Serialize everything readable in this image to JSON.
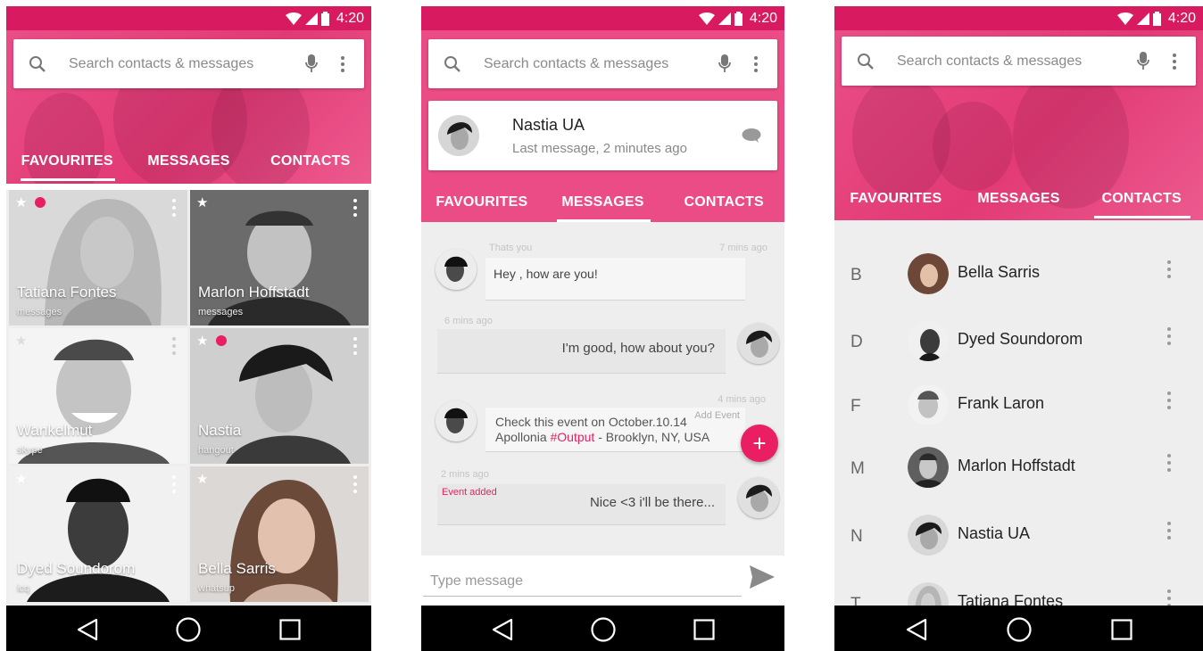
{
  "status_bar": {
    "time": "4:20"
  },
  "search": {
    "placeholder": "Search contacts & messages"
  },
  "tabs": {
    "favourites": "FAVOURITES",
    "messages": "MESSAGES",
    "contacts": "CONTACTS"
  },
  "favourites": [
    {
      "name": "Tatiana Fontes",
      "sub": "messages",
      "starred": true,
      "online": true
    },
    {
      "name": "Marlon Hoffstadt",
      "sub": "messages",
      "starred": true,
      "online": false
    },
    {
      "name": "Wankelmut",
      "sub": "skype",
      "starred": false,
      "online": false
    },
    {
      "name": "Nastia",
      "sub": "hangout",
      "starred": true,
      "online": true
    },
    {
      "name": "Dyed Soundorom",
      "sub": "icq",
      "starred": true,
      "online": false
    },
    {
      "name": "Bella Sarris",
      "sub": "whatsup",
      "starred": true,
      "online": false
    }
  ],
  "conversation": {
    "contact_name": "Nastia UA",
    "last_seen": "Last message, 2 minutes ago",
    "messages": [
      {
        "label": "Thats you",
        "time": "7 mins ago",
        "text": "Hey , how are you!"
      },
      {
        "time": "6 mins ago",
        "text": "I'm good, how about you?"
      },
      {
        "time": "4 mins ago",
        "action": "Add Event",
        "line1": "Check this event on October.10.14",
        "line2_a": "Apollonia ",
        "line2_tag": "#Output",
        "line2_b": " - Brooklyn, NY, USA"
      },
      {
        "time": "2 mins ago",
        "note": "Event added",
        "text": "Nice  <3 i'll be there..."
      }
    ],
    "composer_placeholder": "Type message",
    "fab": "+"
  },
  "contacts": [
    {
      "letter": "B",
      "name": "Bella Sarris"
    },
    {
      "letter": "D",
      "name": "Dyed Soundorom"
    },
    {
      "letter": "F",
      "name": "Frank Laron"
    },
    {
      "letter": "M",
      "name": "Marlon Hoffstadt"
    },
    {
      "letter": "N",
      "name": "Nastia UA"
    },
    {
      "letter": "T",
      "name": "Tatiana Fontes"
    }
  ],
  "icons": {
    "search": "search-icon",
    "mic": "microphone-icon",
    "more": "more-vertical-icon",
    "chat": "chat-bubble-icon",
    "send": "send-icon",
    "back": "back-triangle-icon",
    "home": "home-circle-icon",
    "recents": "recents-square-icon"
  },
  "colors": {
    "primary": "#e91e63",
    "status_bar": "#d81b60",
    "header": "#ea4e86"
  }
}
